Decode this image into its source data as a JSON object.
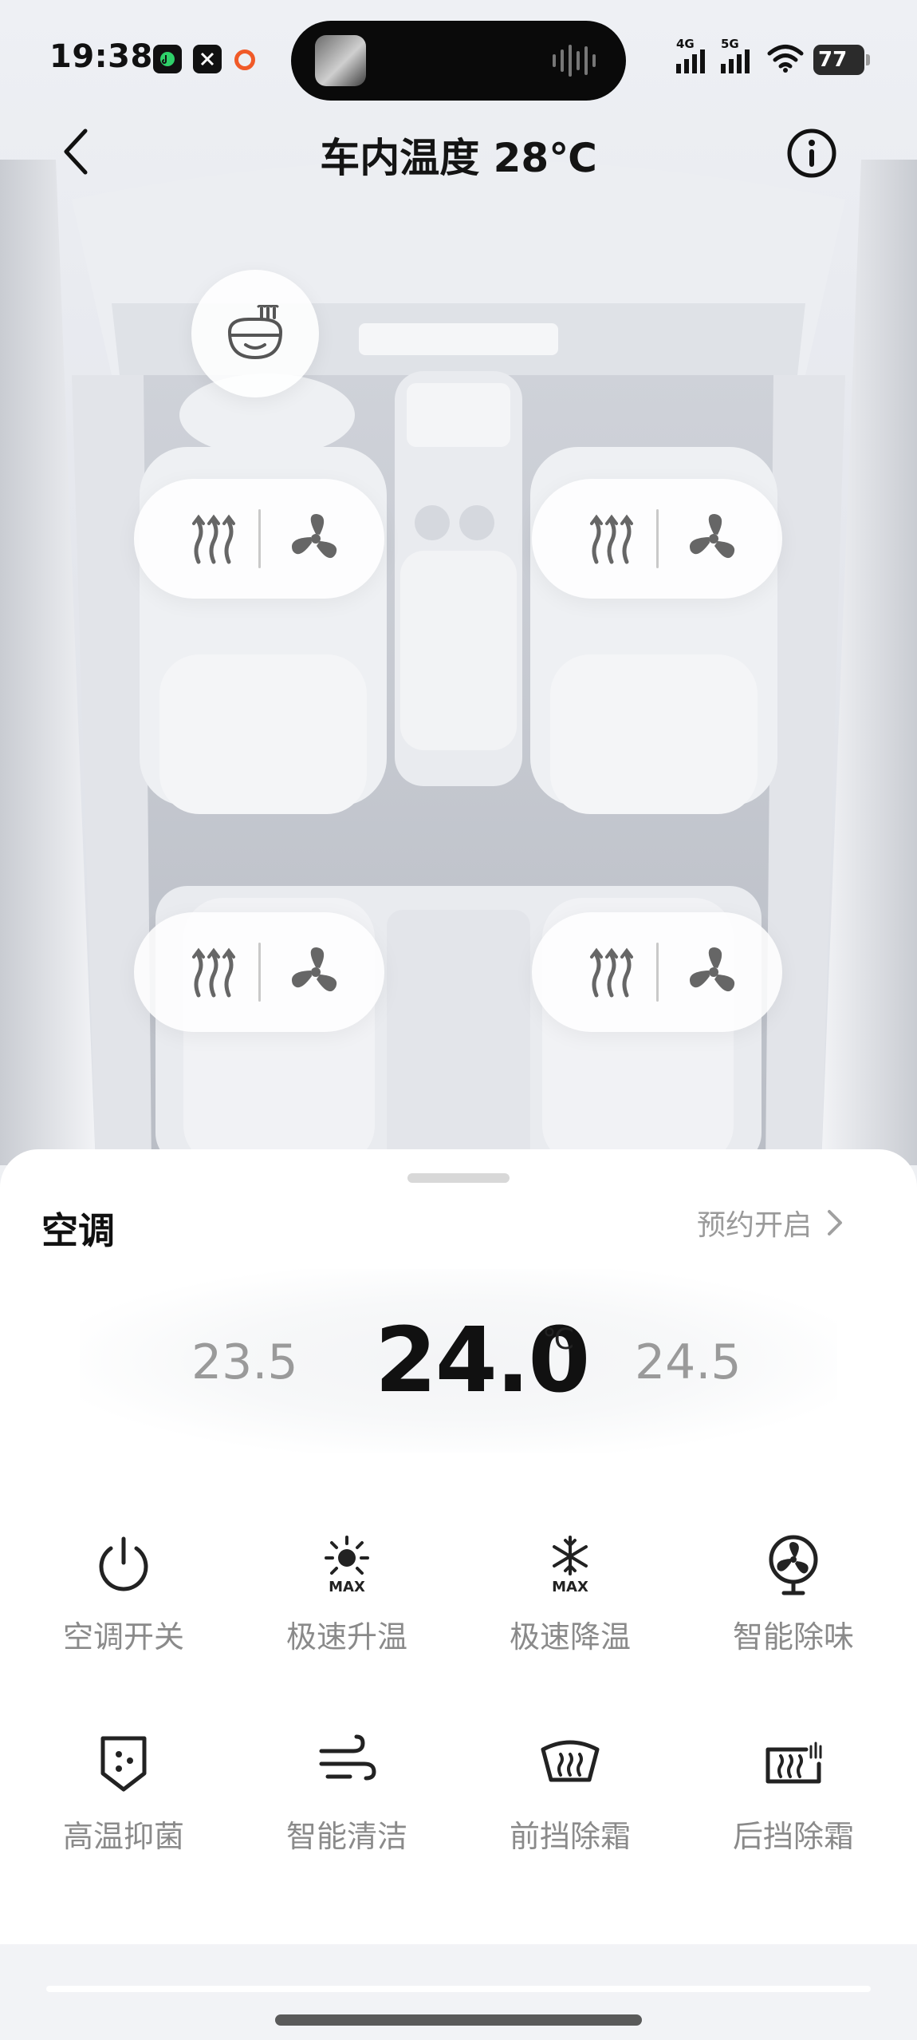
{
  "status_bar": {
    "time": "19:38",
    "network_1": "4G",
    "network_2": "5G",
    "battery": "77",
    "icons": [
      "app-music-icon",
      "app-x-icon",
      "record-indicator-icon",
      "wifi-icon",
      "signal-icon"
    ]
  },
  "header": {
    "title": "车内温度 28℃",
    "back_icon": "chevron-left-icon",
    "info_icon": "info-icon"
  },
  "cabin": {
    "steering_wheel_heat_icon": "steering-wheel-heat-icon",
    "seats": [
      {
        "id": "front-left",
        "heat_icon": "seat-heat-icon",
        "vent_icon": "seat-fan-icon"
      },
      {
        "id": "front-right",
        "heat_icon": "seat-heat-icon",
        "vent_icon": "seat-fan-icon"
      },
      {
        "id": "rear-left",
        "heat_icon": "seat-heat-icon",
        "vent_icon": "seat-fan-icon"
      },
      {
        "id": "rear-right",
        "heat_icon": "seat-heat-icon",
        "vent_icon": "seat-fan-icon"
      }
    ]
  },
  "ac_panel": {
    "title": "空调",
    "schedule_label": "预约开启",
    "temp_lower": "23.5",
    "temp_current": "24.0",
    "temp_unit": "℃",
    "temp_higher": "24.5",
    "functions": [
      {
        "label": "空调开关",
        "icon": "power-icon"
      },
      {
        "label": "极速升温",
        "icon": "max-heat-icon"
      },
      {
        "label": "极速降温",
        "icon": "max-cool-icon"
      },
      {
        "label": "智能除味",
        "icon": "fan-deodorize-icon"
      },
      {
        "label": "高温抑菌",
        "icon": "sterilize-shield-icon"
      },
      {
        "label": "智能清洁",
        "icon": "wind-clean-icon"
      },
      {
        "label": "前挡除霜",
        "icon": "front-defrost-icon"
      },
      {
        "label": "后挡除霜",
        "icon": "rear-defrost-icon"
      }
    ]
  },
  "colors": {
    "accent_orange": "#f05a28",
    "text_primary": "#111111",
    "text_secondary": "#8a8a8a"
  }
}
